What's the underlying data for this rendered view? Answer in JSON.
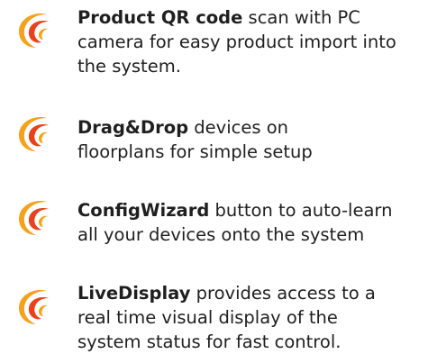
{
  "colors": {
    "logo_outer": "#f5a11a",
    "logo_inner": "#e8421c",
    "text": "#1f1f1f"
  },
  "icon": "swirl-logo-icon",
  "features": [
    {
      "title": "Product QR code",
      "line1": " scan with PC",
      "line2": "camera for easy product import into",
      "line3": "the system."
    },
    {
      "title": "Drag&Drop",
      "line1": " devices on",
      "line2": "floorplans for simple setup",
      "line3": ""
    },
    {
      "title": "ConfigWizard",
      "line1": " button to auto-learn",
      "line2": "all your devices onto the system",
      "line3": ""
    },
    {
      "title": "LiveDisplay",
      "line1": " provides access to a",
      "line2": "real time visual display of the",
      "line3": "system status for fast control."
    }
  ]
}
